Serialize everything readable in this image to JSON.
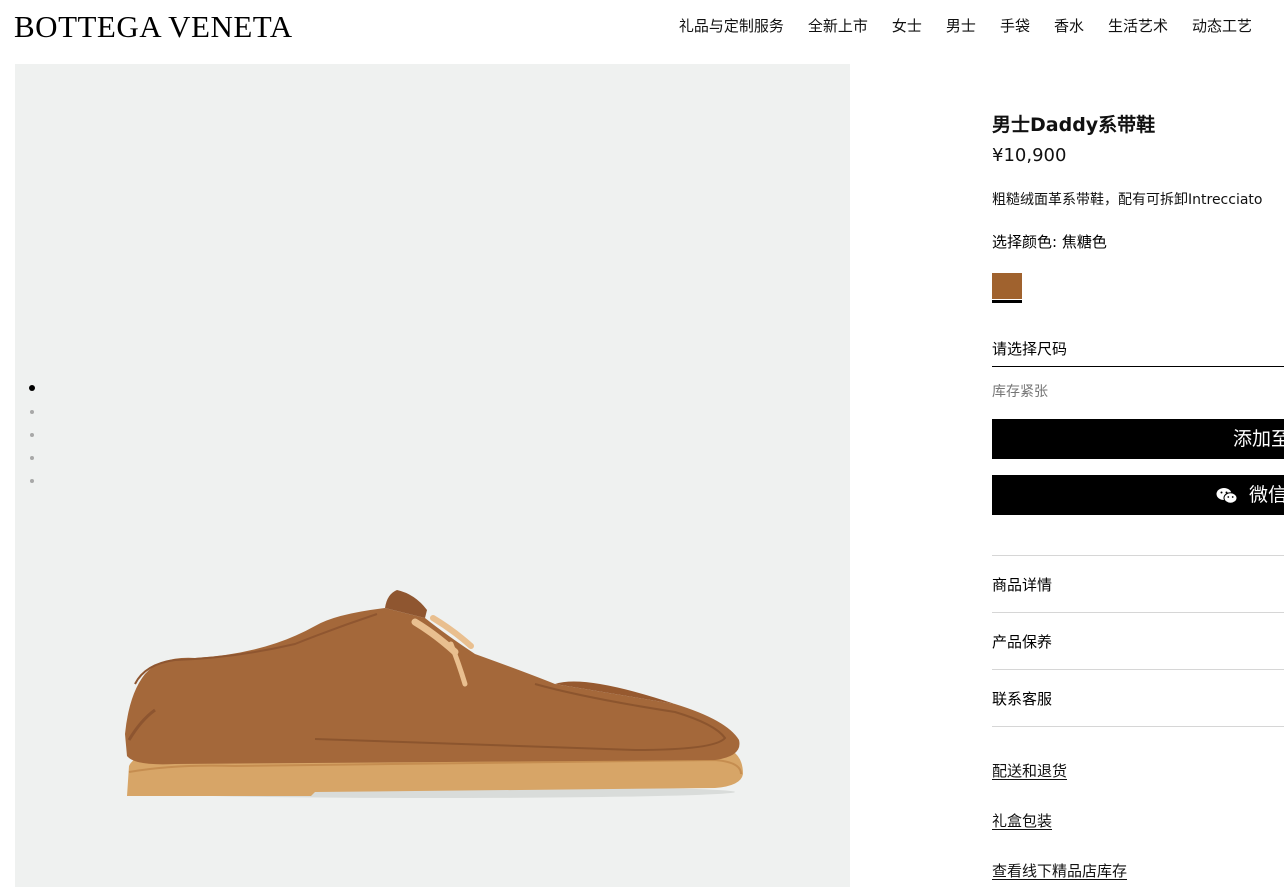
{
  "brand": {
    "logo": "BOTTEGA VENETA"
  },
  "nav": {
    "items": [
      {
        "label": "礼品与定制服务"
      },
      {
        "label": "全新上市"
      },
      {
        "label": "女士"
      },
      {
        "label": "男士"
      },
      {
        "label": "手袋"
      },
      {
        "label": "香水"
      },
      {
        "label": "生活艺术"
      },
      {
        "label": "动态工艺"
      }
    ]
  },
  "gallery": {
    "image_count": 5,
    "active_index": 1
  },
  "product": {
    "title": "男士Daddy系带鞋",
    "price": "¥10,900",
    "description": "粗糙绒面革系带鞋，配有可拆卸Intrecciato",
    "color_label": "选择颜色: 焦糖色",
    "swatch_color": "#a0622e",
    "size_placeholder": "请选择尺码",
    "stock_status": "库存紧张",
    "add_to_cart": "添加至",
    "wechat_button": "微信"
  },
  "accordion": [
    {
      "label": "商品详情"
    },
    {
      "label": "产品保养"
    },
    {
      "label": "联系客服"
    }
  ],
  "links": [
    {
      "label": "配送和退货"
    },
    {
      "label": "礼盒包装"
    },
    {
      "label": "查看线下精品店库存"
    }
  ]
}
